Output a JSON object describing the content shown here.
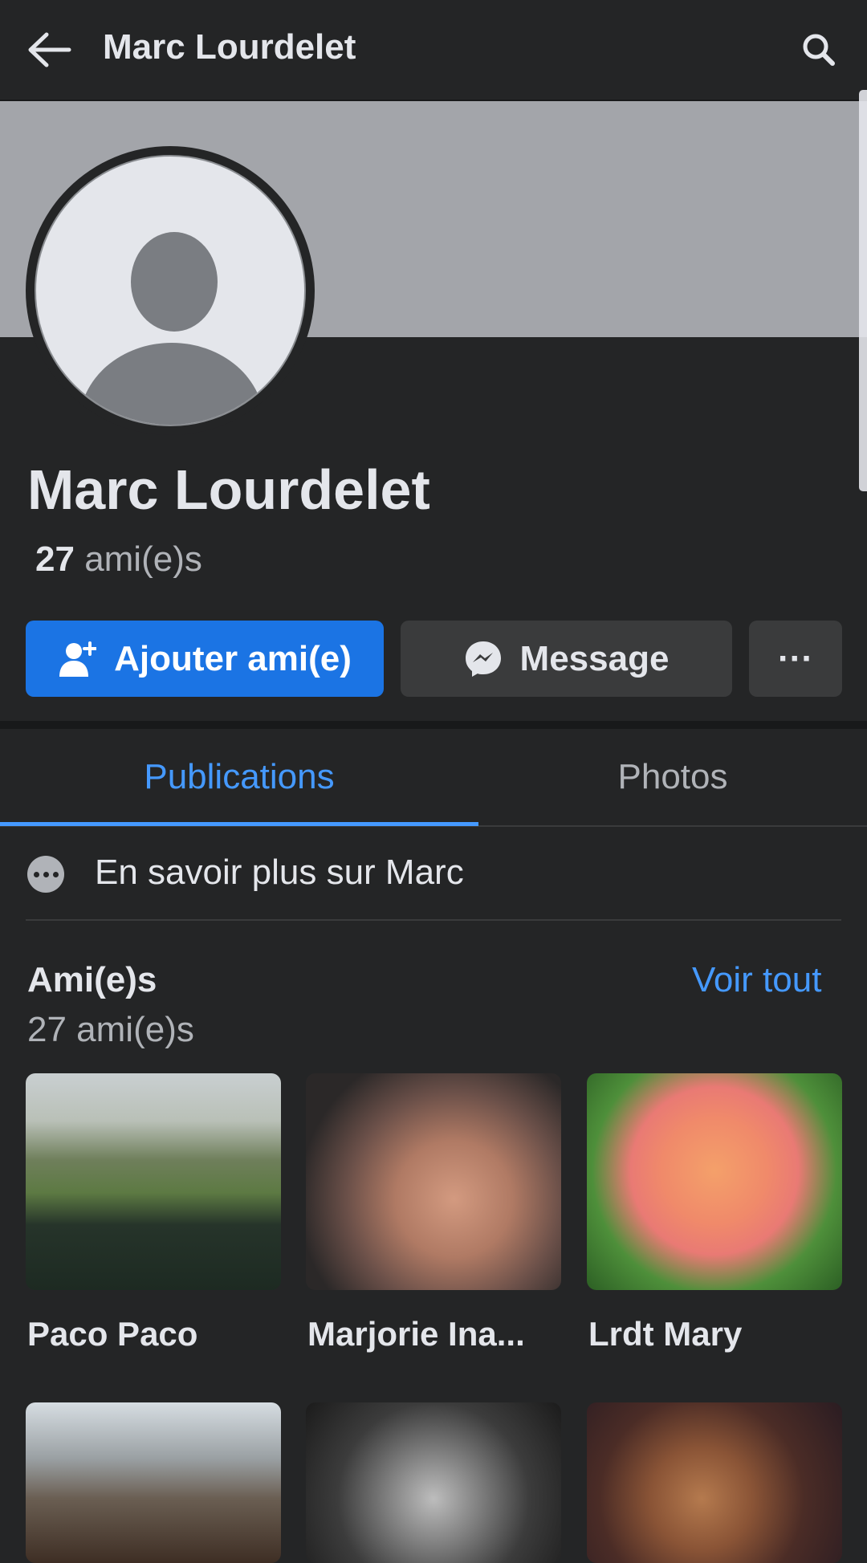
{
  "header": {
    "title": "Marc Lourdelet"
  },
  "profile": {
    "name": "Marc Lourdelet",
    "friends_number": "27",
    "friends_suffix": "ami(e)s"
  },
  "actions": {
    "add_friend_label": "Ajouter ami(e)",
    "message_label": "Message",
    "more_label": "···"
  },
  "tabs": [
    {
      "label": "Publications",
      "active": true
    },
    {
      "label": "Photos",
      "active": false
    }
  ],
  "about": {
    "label": "En savoir plus sur Marc"
  },
  "friends": {
    "title": "Ami(e)s",
    "subtitle": "27 ami(e)s",
    "see_all": "Voir tout",
    "items": [
      {
        "name": "Paco Paco"
      },
      {
        "name": "Marjorie Ina..."
      },
      {
        "name": "Lrdt Mary"
      },
      {
        "name": ""
      },
      {
        "name": ""
      },
      {
        "name": ""
      }
    ]
  },
  "colors": {
    "accent": "#1b74e4",
    "link": "#4599ff",
    "background": "#242526",
    "surface": "#3a3b3c"
  },
  "icons": {
    "back": "arrow-left-icon",
    "search": "search-icon",
    "add_friend": "person-add-icon",
    "message": "messenger-icon",
    "about": "more-dots-icon"
  }
}
